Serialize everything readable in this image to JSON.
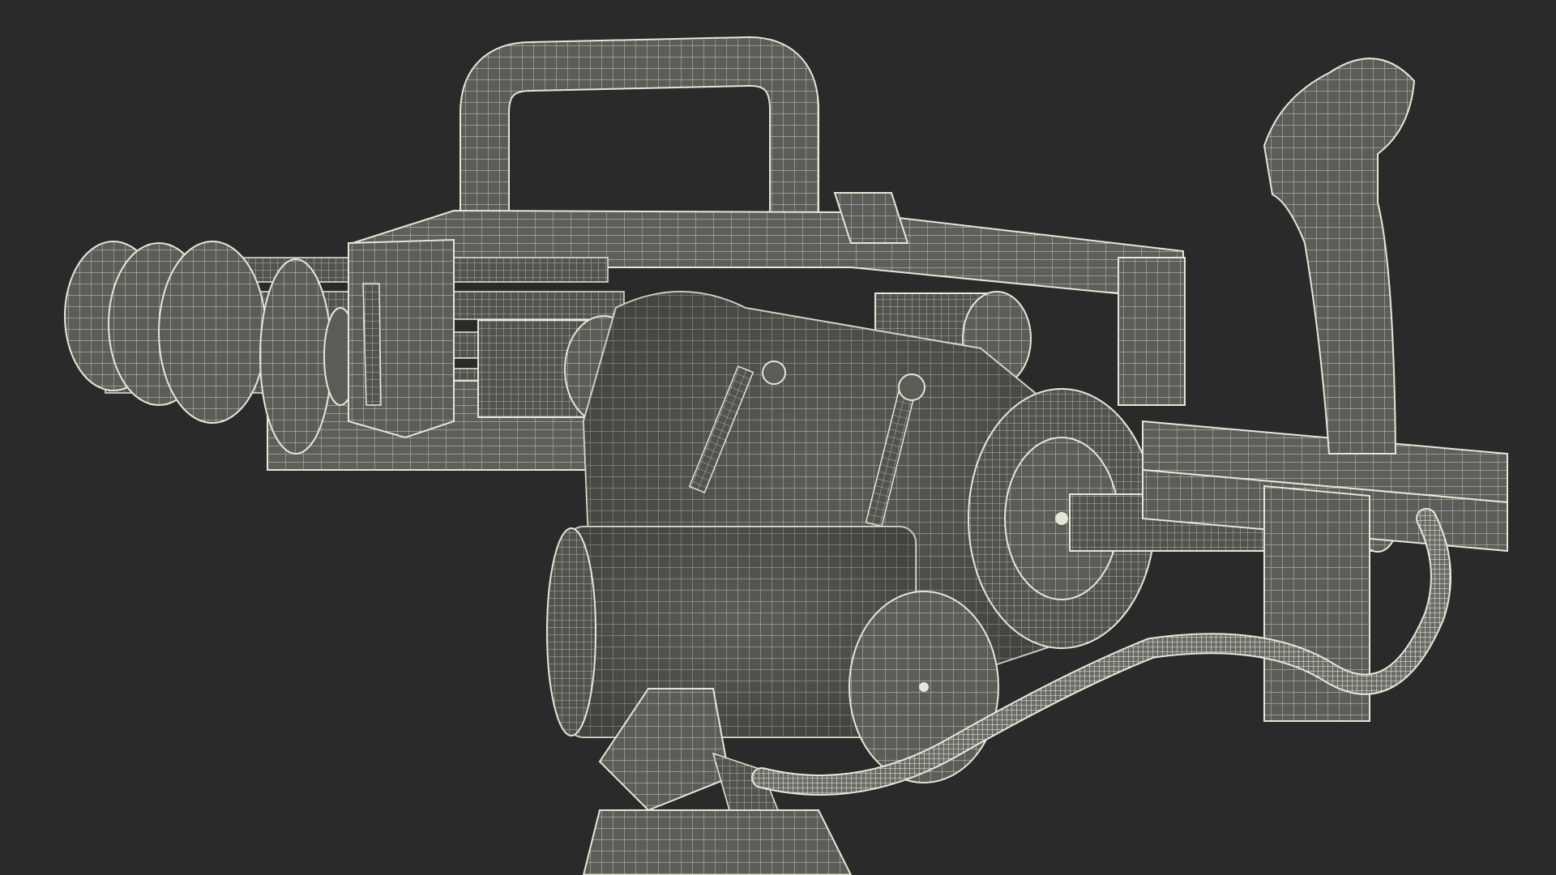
{
  "scene": {
    "subject_icon": "minigun-wireframe-icon",
    "render_mode": "wireframe",
    "colors": {
      "background": "#2a2a2a",
      "shell": "#5c5c58",
      "shell_dark": "#474744",
      "shell_light": "#6a6a66",
      "wire": "#e6e6d8"
    }
  }
}
